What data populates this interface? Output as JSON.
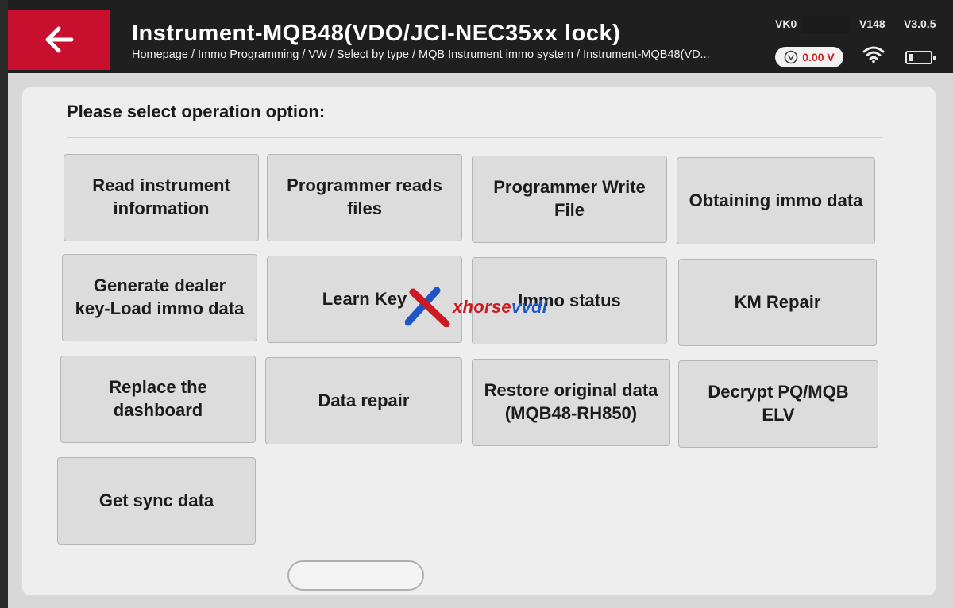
{
  "header": {
    "title": "Instrument-MQB48(VDO/JCI-NEC35xx lock)",
    "breadcrumb": "Homepage / Immo Programming / VW / Select by type / MQB Instrument immo system / Instrument-MQB48(VD...",
    "voltage": "0.00 V",
    "status": {
      "vk": "VK0",
      "v": "V148",
      "version": "V3.0.5"
    },
    "back_icon": "back-arrow-icon",
    "accent": "#c8102e"
  },
  "prompt": "Please select operation option:",
  "operations": [
    "Read instrument\ninformation",
    "Programmer reads\nfiles",
    "Programmer Write\nFile",
    "Obtaining immo data",
    "Generate dealer\nkey-Load immo data",
    "Learn Key",
    "Immo status",
    "KM Repair",
    "Replace the\ndashboard",
    "Data repair",
    "Restore original data\n(MQB48-RH850)",
    "Decrypt PQ/MQB\nELV",
    "Get sync data"
  ],
  "watermark": {
    "mark": "X",
    "prefix": "xhorse",
    "suffix": "vvdi"
  }
}
